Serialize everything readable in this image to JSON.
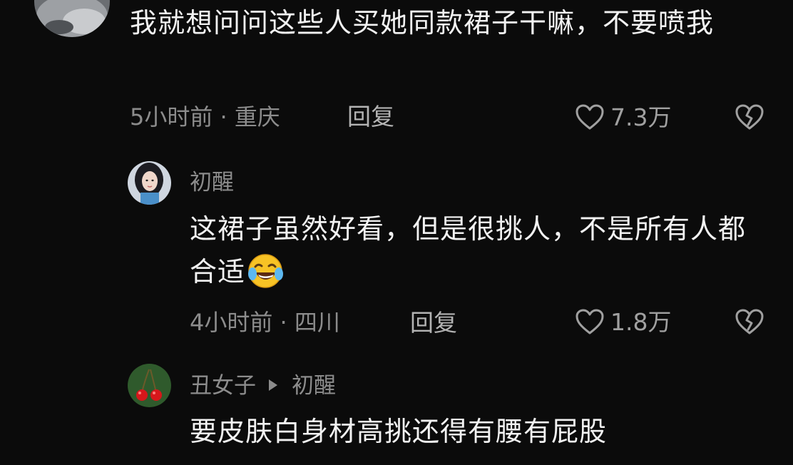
{
  "comments": [
    {
      "username": "",
      "text": "我就想问问这些人买她同款裙子干嘛，不要喷我",
      "time_location": "5小时前 · 重庆",
      "reply_label": "回复",
      "likes": "7.3万",
      "avatar_icon": "user-avatar-icon"
    },
    {
      "username": "初醒",
      "text": "这裙子虽然好看，但是很挑人，不是所有人都合适",
      "emoji": "laughing-tears-emoji",
      "time_location": "4小时前 · 四川",
      "reply_label": "回复",
      "likes": "1.8万",
      "avatar_icon": "user-avatar-icon"
    },
    {
      "username": "丑女子",
      "reply_to": "初醒",
      "text": "要皮肤白身材高挑还得有腰有屁股",
      "avatar_icon": "cherry-avatar-icon"
    }
  ],
  "colors": {
    "background": "#0b0b0b",
    "text": "#f2f2f2",
    "secondary": "#8c8c8c"
  }
}
